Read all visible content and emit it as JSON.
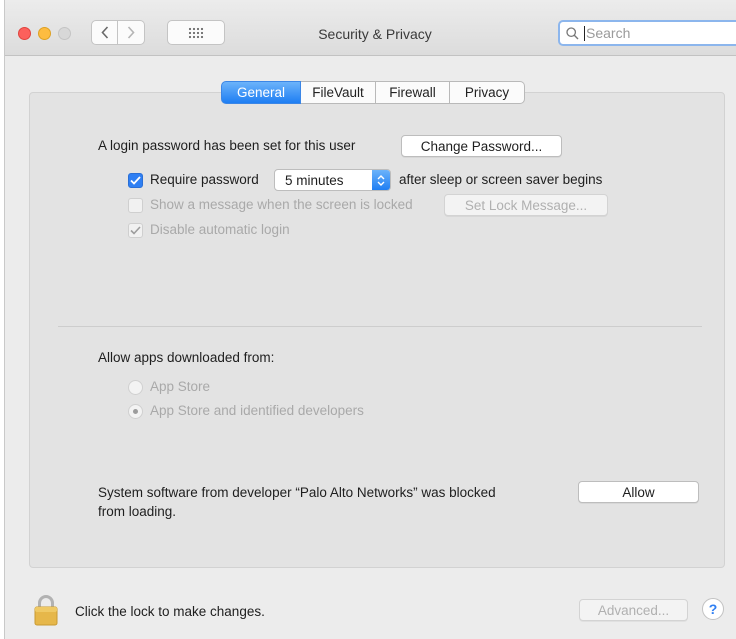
{
  "window": {
    "title": "Security & Privacy"
  },
  "search": {
    "placeholder": "Search"
  },
  "tabs": [
    {
      "label": "General",
      "active": true
    },
    {
      "label": "FileVault",
      "active": false
    },
    {
      "label": "Firewall",
      "active": false
    },
    {
      "label": "Privacy",
      "active": false
    }
  ],
  "general": {
    "login_text": "A login password has been set for this user",
    "change_password_label": "Change Password...",
    "require_password_label": "Require password",
    "require_password_checked": true,
    "require_password_interval": "5 minutes",
    "after_sleep_text": "after sleep or screen saver begins",
    "show_message_label": "Show a message when the screen is locked",
    "show_message_checked": false,
    "set_lock_message_label": "Set Lock Message...",
    "disable_auto_login_label": "Disable automatic login",
    "disable_auto_login_checked": true
  },
  "apps": {
    "heading": "Allow apps downloaded from:",
    "options": [
      {
        "label": "App Store",
        "selected": false
      },
      {
        "label": "App Store and identified developers",
        "selected": true
      }
    ]
  },
  "blocked": {
    "line1": "System software from developer “Palo Alto Networks” was blocked",
    "line2": "from loading.",
    "allow_label": "Allow"
  },
  "footer": {
    "lock_text": "Click the lock to make changes.",
    "advanced_label": "Advanced...",
    "help_label": "?"
  },
  "colors": {
    "accent": "#2f7ff3",
    "close": "#fc605c",
    "minimize": "#fdbc40",
    "lock": "#e6b74a"
  }
}
